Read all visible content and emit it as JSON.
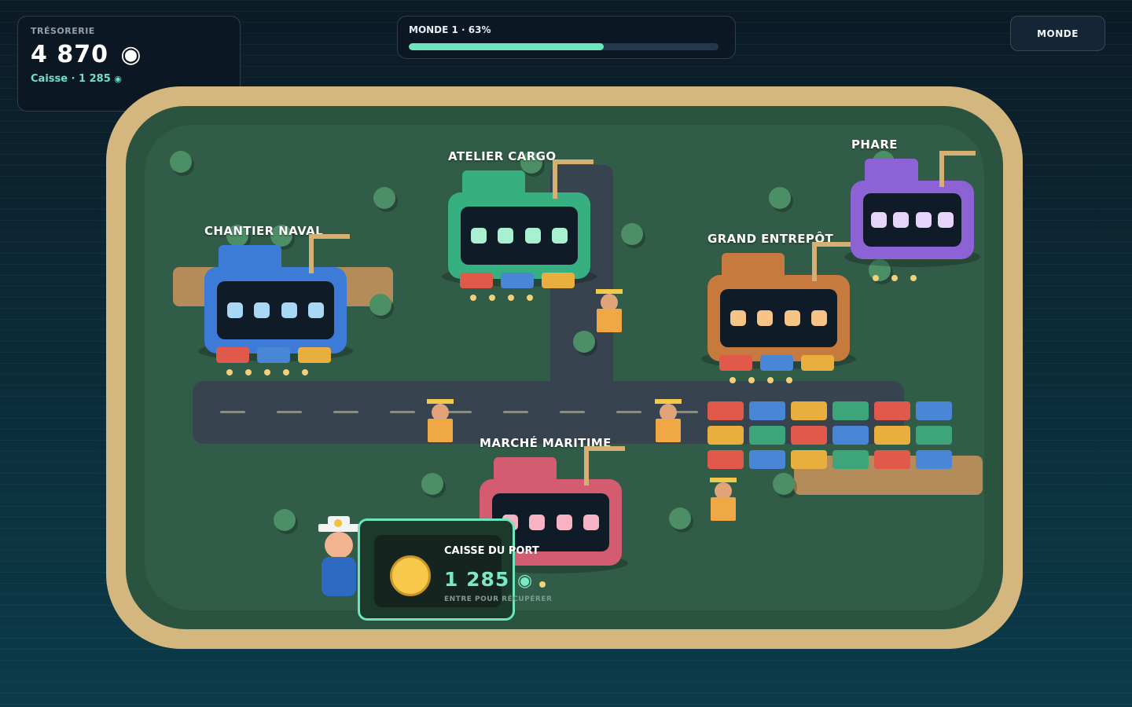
{
  "hud": {
    "treasury_label": "TRÉSORERIE",
    "treasury_amount": "4 870",
    "coin_symbol": "◉",
    "cashbox_line": "Caisse · 1 285",
    "world_progress_label": "MONDE 1 · 63%",
    "world_progress": 0.63,
    "world_button": "MONDE"
  },
  "buildings": [
    {
      "id": "chantier-naval",
      "label": "CHANTIER NAVAL",
      "color": "#3c7bd8",
      "window_color": "#a9d8f7"
    },
    {
      "id": "atelier-cargo",
      "label": "ATELIER CARGO",
      "color": "#36b080",
      "window_color": "#a9f0d0"
    },
    {
      "id": "grand-entrepot",
      "label": "GRAND ENTREPÔT",
      "color": "#c77a3e",
      "window_color": "#f6c486"
    },
    {
      "id": "phare",
      "label": "PHARE",
      "color": "#8c62d4",
      "window_color": "#e6d4fb"
    },
    {
      "id": "marche-maritime",
      "label": "MARCHÉ MARITIME",
      "color": "#d45c70",
      "window_color": "#f7b2c4"
    }
  ],
  "cashbox": {
    "title": "CAISSE DU PORT",
    "amount": "1 285",
    "coin_symbol": "◉",
    "hint": "ENTRE POUR RÉCUPÉRER"
  },
  "colors": {
    "accent": "#6ee4bf",
    "sand": "#d4b77e",
    "grass": "#315c47",
    "road": "#37434f"
  }
}
